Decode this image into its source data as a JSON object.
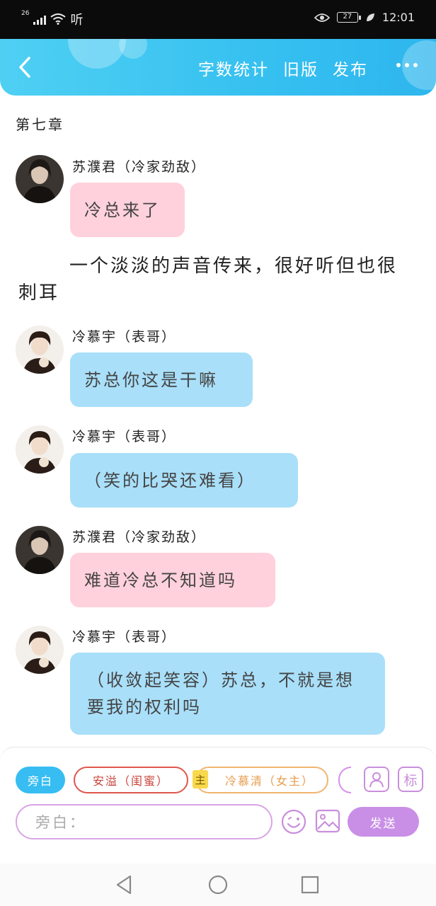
{
  "status": {
    "network": "26",
    "wifi_label": "听",
    "battery": "27",
    "time": "12:01"
  },
  "header": {
    "actions": [
      "字数统计",
      "旧版",
      "发布"
    ]
  },
  "chapter_title": "第七章",
  "messages": [
    {
      "speaker": "苏濮君（冷家劲敌）",
      "text": "冷总来了",
      "color": "pink"
    },
    {
      "speaker": "冷慕宇（表哥）",
      "text": "苏总你这是干嘛",
      "color": "blue"
    },
    {
      "speaker": "冷慕宇（表哥）",
      "text": "（笑的比哭还难看）",
      "color": "blue"
    },
    {
      "speaker": "苏濮君（冷家劲敌）",
      "text": "难道冷总不知道吗",
      "color": "pink"
    },
    {
      "speaker": "冷慕宇（表哥）",
      "text": "（收敛起笑容）苏总，不就是想要我的权利吗",
      "color": "blue"
    }
  ],
  "narration": "一个淡淡的声音传来，很好听但也很刺耳",
  "composer": {
    "roles": [
      "旁白",
      "安溢（闺蜜）",
      "冷慕清（女主）"
    ],
    "main_badge": "主",
    "tag_icon_label": "标",
    "placeholder": "旁白：",
    "send_label": "发送"
  },
  "colors": {
    "header": "#36c0f0",
    "pink_bubble": "#ffd1dc",
    "blue_bubble": "#a9dff9",
    "accent_purple": "#c98fe6"
  },
  "icons": [
    "back-arrow-icon",
    "more-icon",
    "person-card-icon",
    "emoji-icon",
    "image-icon",
    "nav-back-icon",
    "nav-home-icon",
    "nav-recent-icon"
  ]
}
